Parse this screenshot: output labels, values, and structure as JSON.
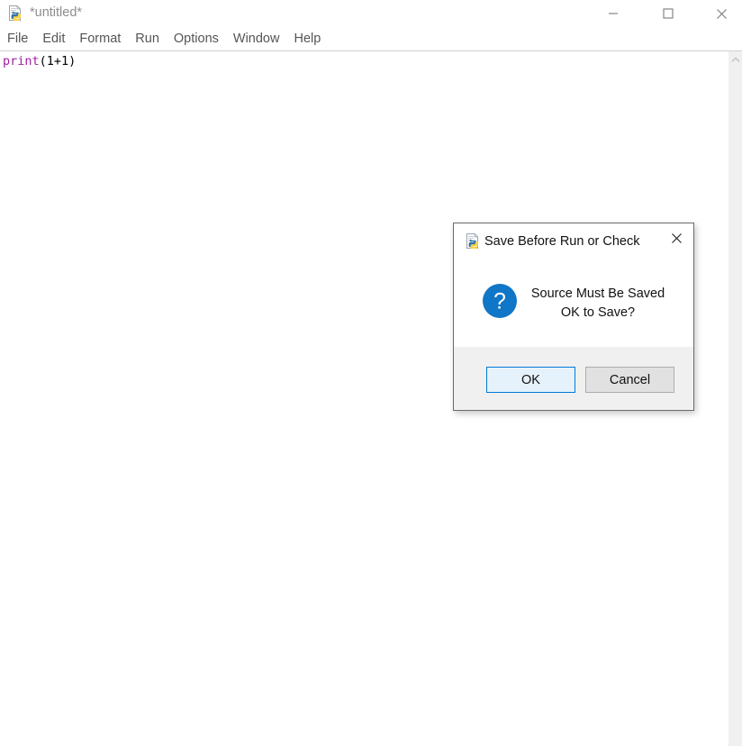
{
  "window": {
    "title": "*untitled*",
    "icon": "python-file-icon",
    "controls": {
      "minimize": "minimize-icon",
      "maximize": "maximize-icon",
      "close": "close-icon"
    }
  },
  "menu": {
    "items": [
      {
        "label": "File"
      },
      {
        "label": "Edit"
      },
      {
        "label": "Format"
      },
      {
        "label": "Run"
      },
      {
        "label": "Options"
      },
      {
        "label": "Window"
      },
      {
        "label": "Help"
      }
    ]
  },
  "editor": {
    "code": {
      "builtin": "print",
      "rest": "(1+1)"
    }
  },
  "scrollbar": {
    "up_arrow": "chevron-up-icon"
  },
  "dialog": {
    "title": "Save Before Run or Check",
    "icon": "python-file-icon",
    "close_icon": "close-icon",
    "question_icon": "question-mark-icon",
    "question_glyph": "?",
    "message_line1": "Source Must Be Saved",
    "message_line2": "OK to Save?",
    "ok_label": "OK",
    "cancel_label": "Cancel"
  },
  "colors": {
    "accent_blue": "#0078d7",
    "question_circle": "#1076c8",
    "ok_fill": "#e5f1fb",
    "cancel_fill": "#e1e1e1",
    "footer_bg": "#f0f0f0",
    "builtin_token": "#a020a0",
    "title_text": "#8d8d8d",
    "menu_text": "#555555"
  }
}
